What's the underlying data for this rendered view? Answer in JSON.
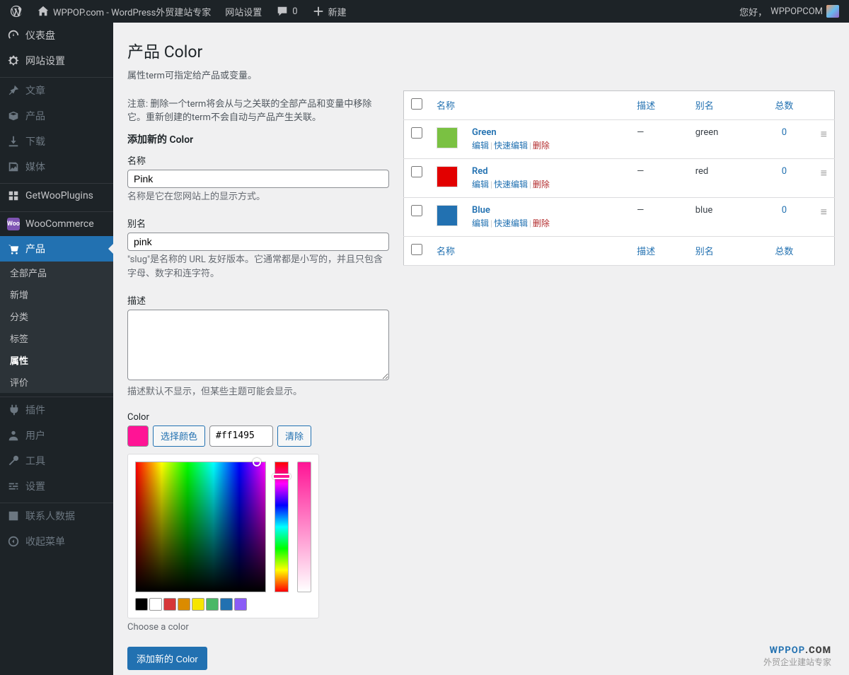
{
  "adminbar": {
    "site_name": "WPPOP.com - WordPress外贸建站专家",
    "site_settings": "网站设置",
    "comment_count": "0",
    "new_label": "新建",
    "greeting": "您好，",
    "username": "WPPOPCOM"
  },
  "sidebar": {
    "dashboard": "仪表盘",
    "site_settings": "网站设置",
    "posts": "文章",
    "products_top": "产品",
    "downloads": "下载",
    "media": "媒体",
    "getwoo": "GetWooPlugins",
    "woocommerce": "WooCommerce",
    "products": "产品",
    "submenu": {
      "all": "全部产品",
      "add": "新增",
      "cat": "分类",
      "tag": "标签",
      "attr": "属性",
      "review": "评价"
    },
    "plugins": "插件",
    "users": "用户",
    "tools": "工具",
    "settings": "设置",
    "contacts": "联系人数据",
    "collapse": "收起菜单"
  },
  "page": {
    "title": "产品 Color",
    "intro": "属性term可指定给产品或变量。",
    "warning": "注意: 删除一个term将会从与之关联的全部产品和变量中移除它。重新创建的term不会自动与产品产生关联。",
    "add_heading": "添加新的 Color",
    "name_label": "名称",
    "name_value": "Pink",
    "name_help": "名称是它在您网站上的显示方式。",
    "slug_label": "别名",
    "slug_value": "pink",
    "slug_help": "\"slug\"是名称的 URL 友好版本。它通常都是小写的，并且只包含字母、数字和连字符。",
    "desc_label": "描述",
    "desc_help": "描述默认不显示，但某些主题可能会显示。",
    "color_label": "Color",
    "pick_color": "选择颜色",
    "color_value": "#ff1495",
    "clear": "清除",
    "choose_color": "Choose a color",
    "submit": "添加新的 Color"
  },
  "table": {
    "cols": {
      "name": "名称",
      "desc": "描述",
      "slug": "别名",
      "count": "总数"
    },
    "actions": {
      "edit": "编辑",
      "quick": "快速编辑",
      "del": "删除"
    },
    "rows": [
      {
        "name": "Green",
        "color": "#7ac142",
        "slug": "green",
        "count": "0"
      },
      {
        "name": "Red",
        "color": "#e20000",
        "slug": "red",
        "count": "0"
      },
      {
        "name": "Blue",
        "color": "#2271b1",
        "slug": "blue",
        "count": "0"
      }
    ]
  },
  "presets": [
    "#000000",
    "#ffffff",
    "#d63638",
    "#db8b00",
    "#f6e500",
    "#4ab866",
    "#2271b1",
    "#8b5cf6"
  ],
  "watermark": {
    "brand1": "WPPOP",
    "brand2": ".COM",
    "sub": "外贸企业建站专家"
  }
}
